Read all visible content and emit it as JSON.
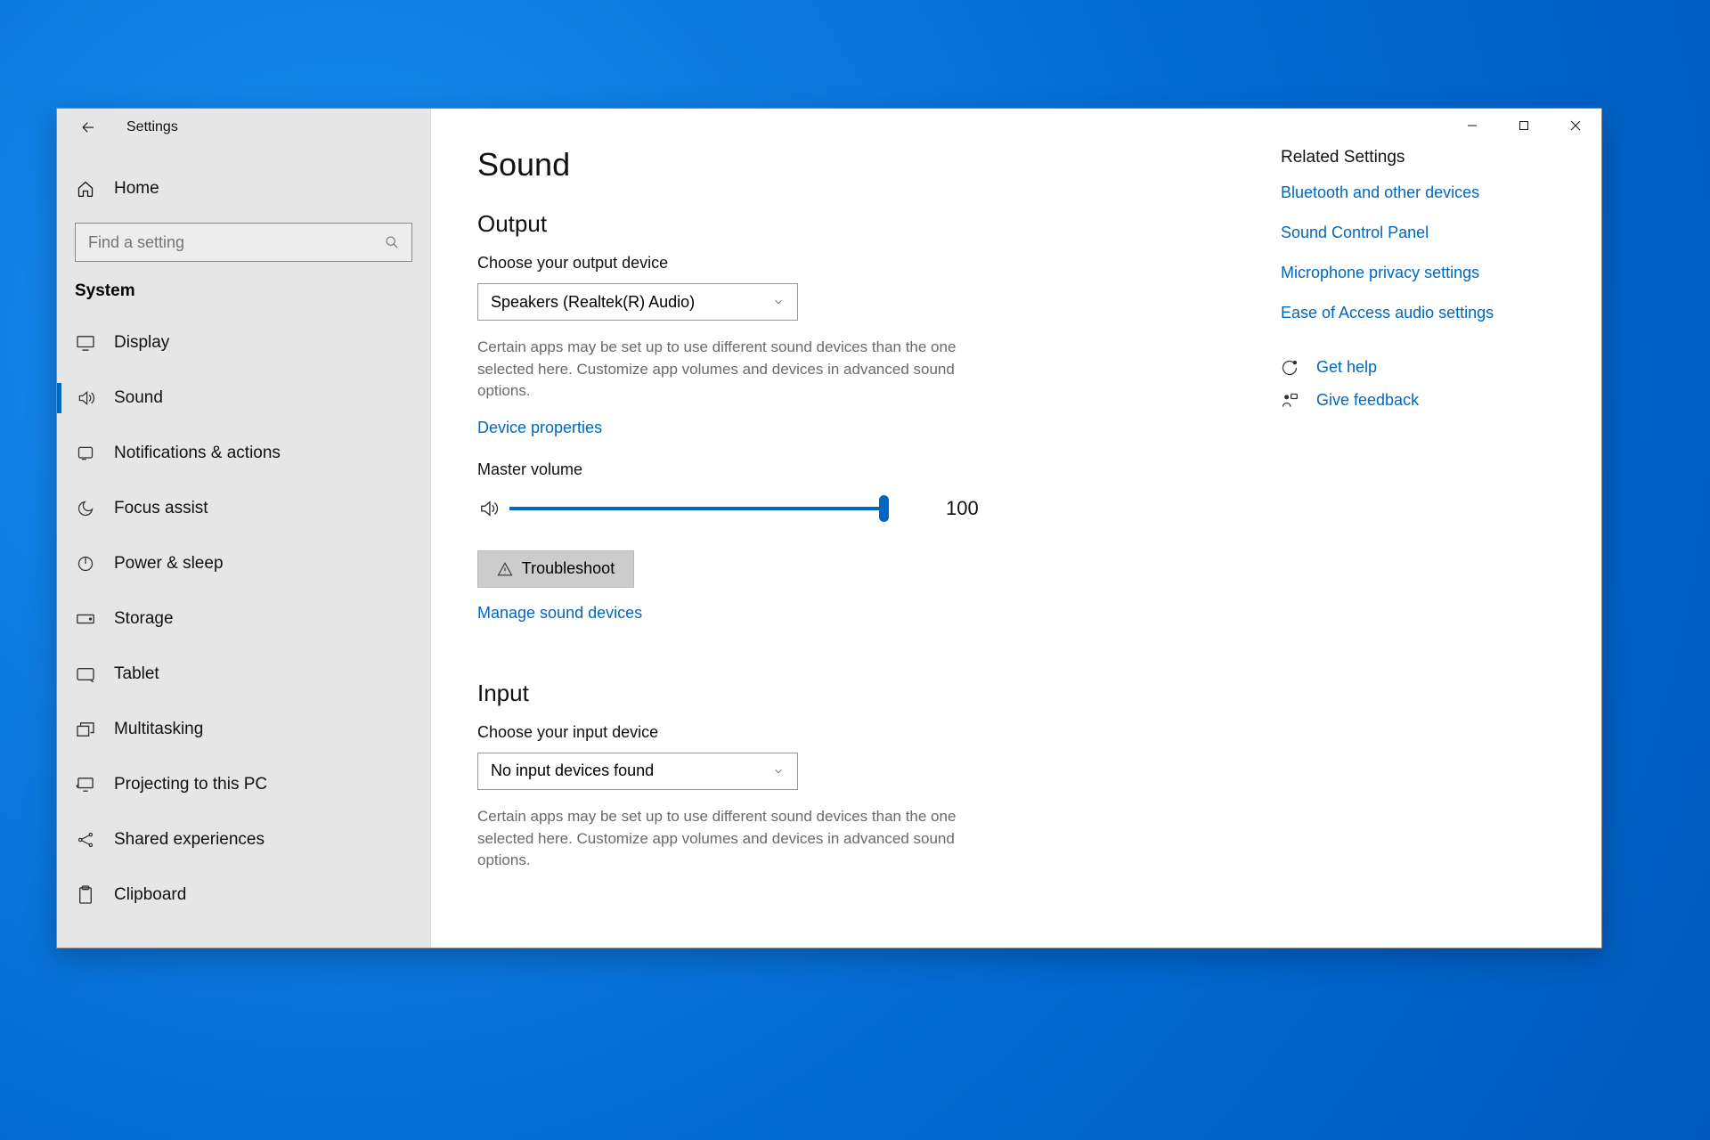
{
  "app_title": "Settings",
  "sidebar": {
    "home_label": "Home",
    "search_placeholder": "Find a setting",
    "category_label": "System",
    "items": [
      {
        "label": "Display",
        "icon": "display"
      },
      {
        "label": "Sound",
        "icon": "sound",
        "active": true
      },
      {
        "label": "Notifications & actions",
        "icon": "notifications"
      },
      {
        "label": "Focus assist",
        "icon": "focus"
      },
      {
        "label": "Power & sleep",
        "icon": "power"
      },
      {
        "label": "Storage",
        "icon": "storage"
      },
      {
        "label": "Tablet",
        "icon": "tablet"
      },
      {
        "label": "Multitasking",
        "icon": "multitasking"
      },
      {
        "label": "Projecting to this PC",
        "icon": "projecting"
      },
      {
        "label": "Shared experiences",
        "icon": "shared"
      },
      {
        "label": "Clipboard",
        "icon": "clipboard"
      }
    ]
  },
  "main": {
    "page_title": "Sound",
    "output": {
      "heading": "Output",
      "choose_label": "Choose your output device",
      "selected_device": "Speakers (Realtek(R) Audio)",
      "hint": "Certain apps may be set up to use different sound devices than the one selected here. Customize app volumes and devices in advanced sound options.",
      "device_properties_link": "Device properties",
      "master_volume_label": "Master volume",
      "master_volume_value": "100",
      "troubleshoot_label": "Troubleshoot",
      "manage_link": "Manage sound devices"
    },
    "input": {
      "heading": "Input",
      "choose_label": "Choose your input device",
      "selected_device": "No input devices found",
      "hint": "Certain apps may be set up to use different sound devices than the one selected here. Customize app volumes and devices in advanced sound options."
    }
  },
  "right_pane": {
    "heading": "Related Settings",
    "links": [
      "Bluetooth and other devices",
      "Sound Control Panel",
      "Microphone privacy settings",
      "Ease of Access audio settings"
    ],
    "get_help": "Get help",
    "give_feedback": "Give feedback"
  }
}
